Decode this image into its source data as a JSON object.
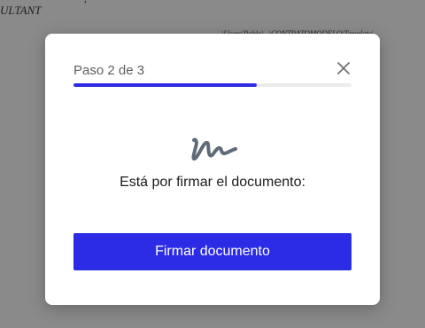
{
  "background": {
    "doc_text_left_top": ",",
    "doc_text_left": "ULTANT",
    "doc_text_right": "\\Users\\Pablo\\...\\CONTRATOMODELO\\Template\\"
  },
  "modal": {
    "step_label": "Paso 2 de 3",
    "progress_fraction": 0.66,
    "prompt": "Está por firmar el documento:",
    "sign_button_label": "Firmar documento"
  },
  "colors": {
    "accent": "#2c2be6",
    "track": "#ebebeb",
    "icon": "#5f6b78"
  },
  "icons": {
    "close": "close-icon",
    "signature": "signature-icon"
  }
}
